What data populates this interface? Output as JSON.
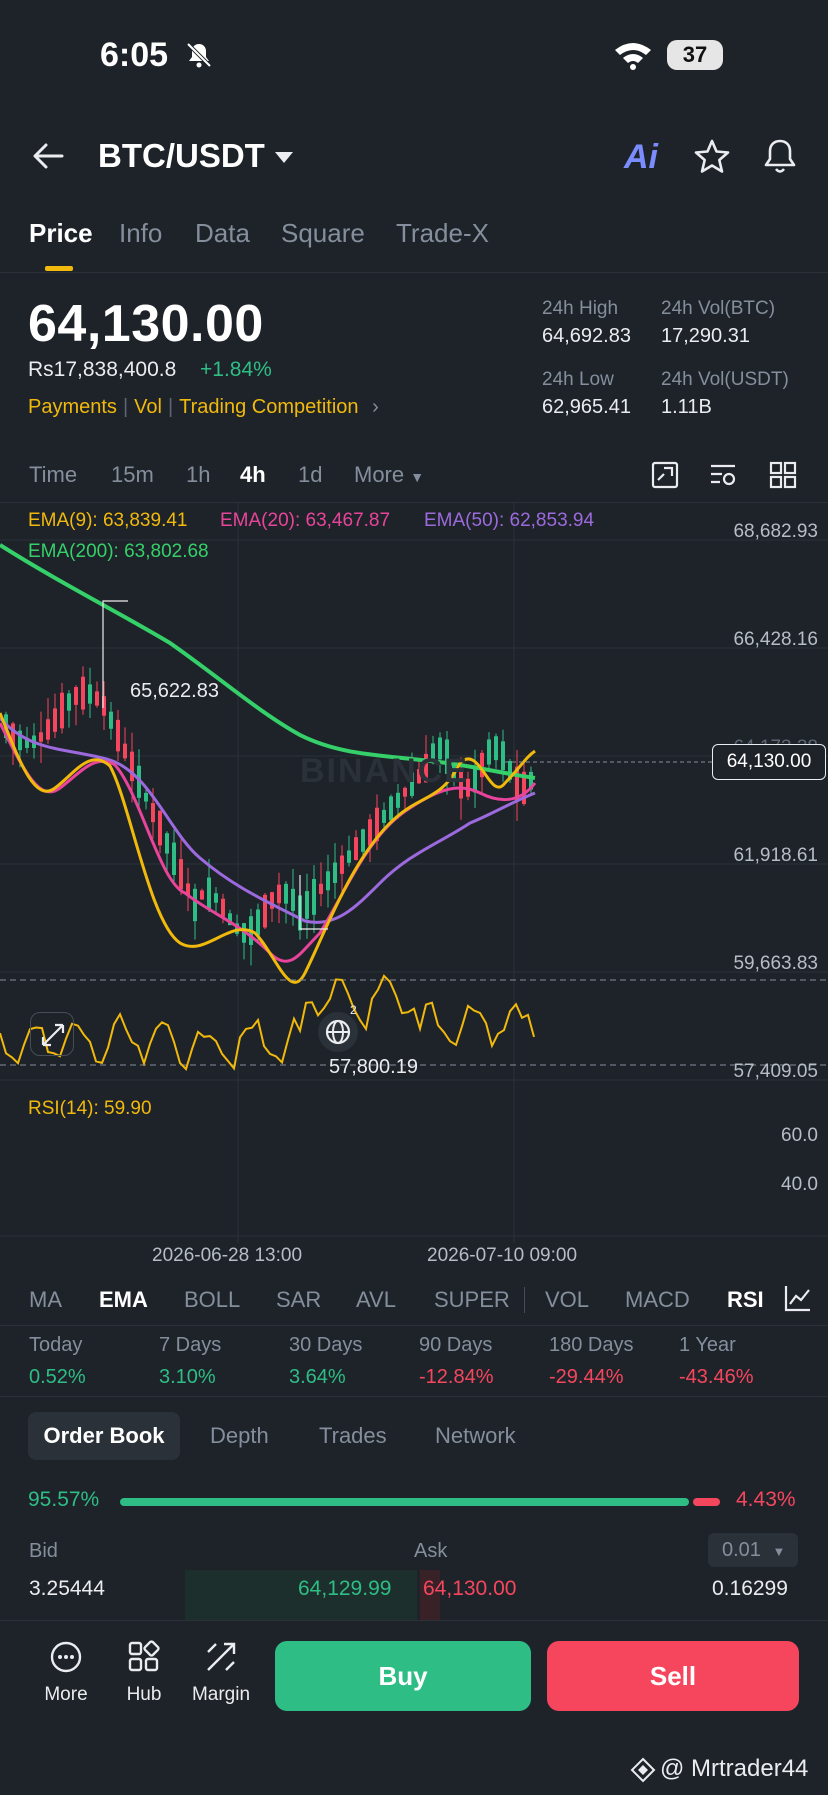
{
  "status_bar": {
    "time": "6:05",
    "battery": "37"
  },
  "header": {
    "title": "BTC/USDT",
    "ai_label": "Ai"
  },
  "tabs": [
    "Price",
    "Info",
    "Data",
    "Square",
    "Trade-X"
  ],
  "price": {
    "last": "64,130.00",
    "fiat": "Rs17,838,400.8",
    "change": "+1.84%",
    "tags": [
      "Payments",
      "Vol",
      "Trading Competition"
    ]
  },
  "stats": {
    "high_label": "24h High",
    "high_value": "64,692.83",
    "vol_btc_label": "24h Vol(BTC)",
    "vol_btc_value": "17,290.31",
    "low_label": "24h Low",
    "low_value": "62,965.41",
    "vol_usdt_label": "24h Vol(USDT)",
    "vol_usdt_value": "1.11B"
  },
  "intervals": [
    "Time",
    "15m",
    "1h",
    "4h",
    "1d",
    "More"
  ],
  "chart": {
    "ema9": "EMA(9): 63,839.41",
    "ema20": "EMA(20): 63,467.87",
    "ema50": "EMA(50): 62,853.94",
    "ema200": "EMA(200): 63,802.68",
    "y_axis": [
      "68,682.93",
      "66,428.16",
      "64,173.38",
      "61,918.61",
      "59,663.83",
      "57,409.05"
    ],
    "current_price_tag": "64,130.00",
    "high_marker": "65,622.83",
    "low_marker": "57,800.19",
    "watermark": "BINANCE",
    "rsi_label": "RSI(14): 59.90",
    "rsi_levels": [
      "60.0",
      "40.0"
    ],
    "x_axis": [
      "2026-06-28 13:00",
      "2026-07-10 09:00"
    ],
    "globe_badge": "2"
  },
  "chart_data": {
    "type": "line",
    "x": [
      "2026-06-28 13:00",
      "2026-07-10 09:00"
    ],
    "ylim": [
      57409.05,
      68682.93
    ],
    "series": [
      {
        "name": "EMA(9)",
        "values": [
          63839.41
        ]
      },
      {
        "name": "EMA(20)",
        "values": [
          63467.87
        ]
      },
      {
        "name": "EMA(50)",
        "values": [
          62853.94
        ]
      },
      {
        "name": "EMA(200)",
        "values": [
          63802.68
        ]
      }
    ]
  },
  "indicators": [
    "MA",
    "EMA",
    "BOLL",
    "SAR",
    "AVL",
    "SUPER",
    "VOL",
    "MACD",
    "RSI"
  ],
  "performance": [
    {
      "label": "Today",
      "value": "0.52%",
      "dir": "up"
    },
    {
      "label": "7 Days",
      "value": "3.10%",
      "dir": "up"
    },
    {
      "label": "30 Days",
      "value": "3.64%",
      "dir": "up"
    },
    {
      "label": "90 Days",
      "value": "-12.84%",
      "dir": "down"
    },
    {
      "label": "180 Days",
      "value": "-29.44%",
      "dir": "down"
    },
    {
      "label": "1 Year",
      "value": "-43.46%",
      "dir": "down"
    }
  ],
  "order_book": {
    "tabs": [
      "Order Book",
      "Depth",
      "Trades",
      "Network"
    ],
    "bid_ratio": "95.57%",
    "ask_ratio": "4.43%",
    "bid_fraction": 0.9557,
    "bid_header": "Bid",
    "ask_header": "Ask",
    "precision": "0.01",
    "rows": [
      {
        "bid_qty": "3.25444",
        "bid_price": "64,129.99",
        "ask_price": "64,130.00",
        "ask_qty": "0.16299"
      }
    ]
  },
  "bottom_nav": {
    "more": "More",
    "hub": "Hub",
    "margin": "Margin",
    "buy": "Buy",
    "sell": "Sell"
  },
  "credit": "@ Mrtrader44",
  "colors": {
    "green": "#2ebd85",
    "red": "#f6465d",
    "yellow": "#f0b90b",
    "ema9": "#f0b90b",
    "ema20": "#e8449b",
    "ema50": "#9c6ade",
    "ema200": "#35d069"
  }
}
